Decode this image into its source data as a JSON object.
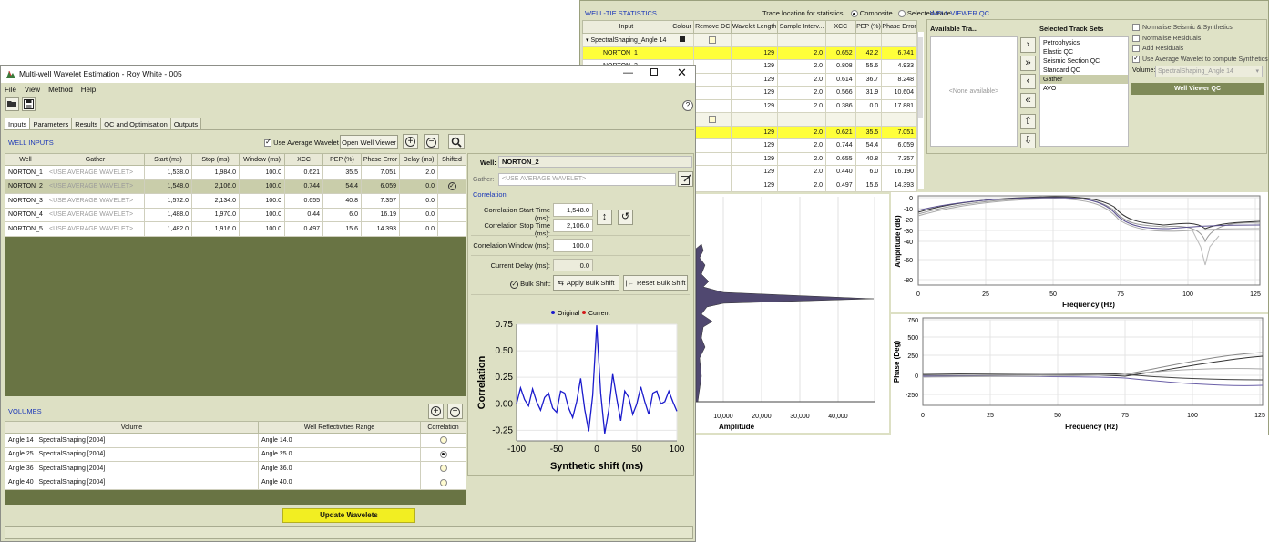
{
  "well_tie": {
    "title": "WELL-TIE STATISTICS",
    "trace_location_label": "Trace location for statistics:",
    "composite_label": "Composite",
    "selected_trace_label": "Selected trace",
    "viewer_qc_title": "WELL VIEWER QC",
    "columns": [
      "Input",
      "Colour",
      "Remove DC",
      "Wavelet Length",
      "Sample Interv...",
      "XCC",
      "PEP (%)",
      "Phase Error"
    ],
    "group_label": "SpectralShaping_Angle  14",
    "rows": [
      {
        "input": "NORTON_1",
        "wl": "129",
        "si": "2.0",
        "xcc": "0.652",
        "pep": "42.2",
        "pe": "6.741",
        "hl": true
      },
      {
        "input": "NORTON_2",
        "wl": "129",
        "si": "2.0",
        "xcc": "0.808",
        "pep": "55.6",
        "pe": "4.933",
        "hl": false
      },
      {
        "input": "",
        "wl": "129",
        "si": "2.0",
        "xcc": "0.614",
        "pep": "36.7",
        "pe": "8.248",
        "hl": false
      },
      {
        "input": "",
        "wl": "129",
        "si": "2.0",
        "xcc": "0.566",
        "pep": "31.9",
        "pe": "10.604",
        "hl": false
      },
      {
        "input": "",
        "wl": "129",
        "si": "2.0",
        "xcc": "0.386",
        "pep": "0.0",
        "pe": "17.881",
        "hl": false
      },
      {
        "input": "",
        "wl": "",
        "si": "",
        "xcc": "",
        "pep": "",
        "pe": "",
        "hl": false,
        "grp": true
      },
      {
        "input": "",
        "wl": "129",
        "si": "2.0",
        "xcc": "0.621",
        "pep": "35.5",
        "pe": "7.051",
        "hl": true
      },
      {
        "input": "",
        "wl": "129",
        "si": "2.0",
        "xcc": "0.744",
        "pep": "54.4",
        "pe": "6.059",
        "hl": false
      },
      {
        "input": "",
        "wl": "129",
        "si": "2.0",
        "xcc": "0.655",
        "pep": "40.8",
        "pe": "7.357",
        "hl": false
      },
      {
        "input": "",
        "wl": "129",
        "si": "2.0",
        "xcc": "0.440",
        "pep": "6.0",
        "pe": "16.190",
        "hl": false
      },
      {
        "input": "",
        "wl": "129",
        "si": "2.0",
        "xcc": "0.497",
        "pep": "15.6",
        "pe": "14.393",
        "hl": false
      }
    ],
    "available_tracks_label": "Available Tra...",
    "none_available": "<None available>",
    "selected_track_sets_label": "Selected Track Sets",
    "track_sets": [
      "Petrophysics",
      "Elastic QC",
      "Seismic Section QC",
      "Standard QC",
      "Gather",
      "AVO"
    ],
    "selected_track_index": 4,
    "options": [
      "Normalise Seismic & Synthetics",
      "Normalise Residuals",
      "Add Residuals",
      "Use Average Wavelet to compute Synthetics"
    ],
    "volume_label": "Volume:",
    "volume_value": "SpectralShaping_Angle  14",
    "viewer_qc_button": "Well Viewer QC",
    "amp_xlabel": "Amplitude",
    "amp_ticks": [
      "10,000",
      "20,000",
      "30,000",
      "40,000"
    ],
    "amp_db_label": "Amplitude (dB)",
    "amp_db_ticks": [
      "0",
      "-10",
      "-20",
      "-30",
      "-40",
      "-60",
      "-80"
    ],
    "freq_ticks": [
      "0",
      "25",
      "50",
      "75",
      "100",
      "125"
    ],
    "freq_label": "Frequency (Hz)",
    "phase_label": "Phase (Deg)",
    "phase_ticks": [
      "750",
      "500",
      "250",
      "0",
      "-250"
    ]
  },
  "main_window": {
    "title": "Multi-well Wavelet Estimation - Roy White - 005",
    "menu": [
      "File",
      "View",
      "Method",
      "Help"
    ],
    "tabs": [
      "Inputs",
      "Parameters",
      "Results",
      "QC and Optimisation",
      "Outputs"
    ],
    "well_inputs_title": "WELL INPUTS",
    "use_average_wavelet": "Use Average Wavelet",
    "open_well_viewer": "Open Well Viewer",
    "columns": [
      "Well",
      "Gather",
      "Start (ms)",
      "Stop (ms)",
      "Window (ms)",
      "XCC",
      "PEP (%)",
      "Phase Error",
      "Delay (ms)",
      "Shifted"
    ],
    "wells": [
      {
        "well": "NORTON_1",
        "gather": "<USE AVERAGE WAVELET>",
        "start": "1,538.0",
        "stop": "1,984.0",
        "window": "100.0",
        "xcc": "0.621",
        "pep": "35.5",
        "pe": "7.051",
        "delay": "2.0",
        "shifted": false,
        "sel": false
      },
      {
        "well": "NORTON_2",
        "gather": "<USE AVERAGE WAVELET>",
        "start": "1,548.0",
        "stop": "2,106.0",
        "window": "100.0",
        "xcc": "0.744",
        "pep": "54.4",
        "pe": "6.059",
        "delay": "0.0",
        "shifted": true,
        "sel": true
      },
      {
        "well": "NORTON_3",
        "gather": "<USE AVERAGE WAVELET>",
        "start": "1,572.0",
        "stop": "2,134.0",
        "window": "100.0",
        "xcc": "0.655",
        "pep": "40.8",
        "pe": "7.357",
        "delay": "0.0",
        "shifted": false,
        "sel": false
      },
      {
        "well": "NORTON_4",
        "gather": "<USE AVERAGE WAVELET>",
        "start": "1,488.0",
        "stop": "1,970.0",
        "window": "100.0",
        "xcc": "0.44",
        "pep": "6.0",
        "pe": "16.19",
        "delay": "0.0",
        "shifted": false,
        "sel": false
      },
      {
        "well": "NORTON_5",
        "gather": "<USE AVERAGE WAVELET>",
        "start": "1,482.0",
        "stop": "1,916.0",
        "window": "100.0",
        "xcc": "0.497",
        "pep": "15.6",
        "pe": "14.393",
        "delay": "0.0",
        "shifted": false,
        "sel": false
      }
    ],
    "well_label": "Well:",
    "well_value": "NORTON_2",
    "gather_label": "Gather:",
    "gather_value": "<USE AVERAGE WAVELET>",
    "correlation_title": "Correlation",
    "corr_start_label": "Correlation Start Time (ms):",
    "corr_start_value": "1,548.0",
    "corr_stop_label": "Correlation Stop Time (ms):",
    "corr_stop_value": "2,106.0",
    "corr_window_label": "Correlation Window (ms):",
    "corr_window_value": "100.0",
    "current_delay_label": "Current Delay (ms):",
    "current_delay_value": "0.0",
    "bulk_shift_label": "Bulk Shift:",
    "apply_bulk_shift": "Apply Bulk Shift",
    "reset_bulk_shift": "Reset Bulk Shift",
    "volumes_title": "VOLUMES",
    "volume_columns": [
      "Volume",
      "Well Reflectivities Range",
      "Correlation"
    ],
    "volumes": [
      {
        "volume": "Angle  14 : SpectralShaping [2004]",
        "range": "Angle 14.0",
        "on": false
      },
      {
        "volume": "Angle  25 : SpectralShaping [2004]",
        "range": "Angle 25.0",
        "on": true
      },
      {
        "volume": "Angle  36 : SpectralShaping [2004]",
        "range": "Angle 36.0",
        "on": false
      },
      {
        "volume": "Angle  40 : SpectralShaping [2004]",
        "range": "Angle 40.0",
        "on": false
      }
    ],
    "update_wavelets": "Update Wavelets"
  },
  "chart_data": {
    "type": "line",
    "title": "",
    "xlabel": "Synthetic shift (ms)",
    "ylabel": "Correlation",
    "xlim": [
      -100,
      100
    ],
    "ylim": [
      -0.35,
      0.75
    ],
    "xticks": [
      "-100",
      "-50",
      "0",
      "50",
      "100"
    ],
    "yticks": [
      "0.75",
      "0.50",
      "0.25",
      "0.00",
      "-0.25"
    ],
    "legend": [
      "Original",
      "Current"
    ],
    "series": [
      {
        "name": "Original",
        "color": "#1a1acc",
        "x": [
          -100,
          -95,
          -90,
          -85,
          -80,
          -75,
          -70,
          -65,
          -60,
          -55,
          -50,
          -45,
          -40,
          -35,
          -30,
          -25,
          -20,
          -15,
          -10,
          -5,
          0,
          5,
          10,
          15,
          20,
          25,
          30,
          35,
          40,
          45,
          50,
          55,
          60,
          65,
          70,
          75,
          80,
          85,
          90,
          95,
          100
        ],
        "y": [
          0.0,
          0.15,
          0.04,
          -0.02,
          0.14,
          0.02,
          -0.06,
          0.06,
          0.1,
          -0.04,
          -0.08,
          0.12,
          0.1,
          -0.04,
          -0.13,
          0.02,
          0.24,
          -0.05,
          -0.26,
          0.08,
          0.74,
          0.1,
          -0.28,
          -0.06,
          0.28,
          0.05,
          -0.16,
          0.12,
          0.06,
          -0.1,
          0.0,
          0.16,
          0.02,
          -0.1,
          0.1,
          0.12,
          0.0,
          0.02,
          0.12,
          0.02,
          -0.07
        ]
      }
    ]
  }
}
